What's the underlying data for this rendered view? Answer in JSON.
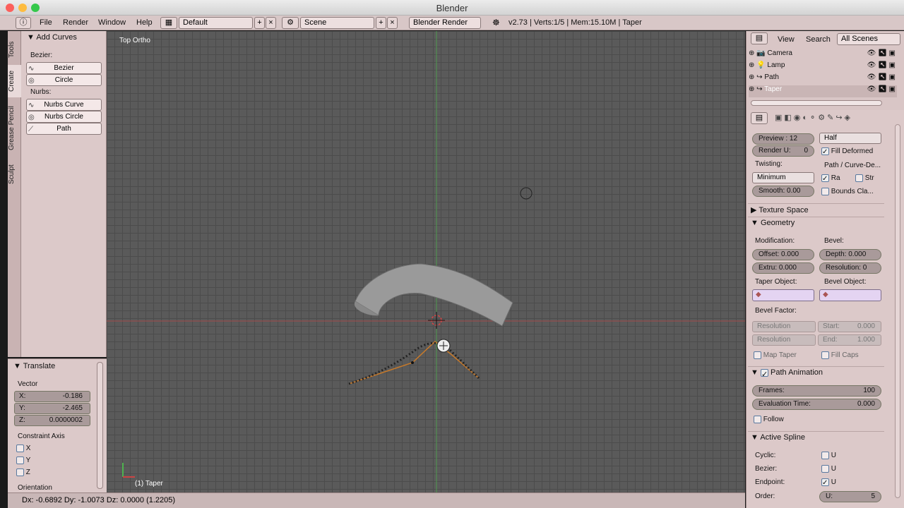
{
  "window": {
    "title": "Blender"
  },
  "menu": [
    "File",
    "Render",
    "Window",
    "Help"
  ],
  "screen_layout": "Default",
  "scene": "Scene",
  "engine": "Blender Render",
  "stats": "v2.73 | Verts:1/5 | Mem:15.10M | Taper",
  "tool_tabs": [
    "Tools",
    "Create",
    "Grease Pencil",
    "Sculpt"
  ],
  "add_curves": {
    "title": "Add Curves",
    "bezier_label": "Bezier:",
    "bezier_buttons": [
      "Bezier",
      "Circle"
    ],
    "nurbs_label": "Nurbs:",
    "nurbs_buttons": [
      "Nurbs Curve",
      "Nurbs Circle",
      "Path"
    ]
  },
  "translate": {
    "title": "Translate",
    "vector_label": "Vector",
    "x_label": "X:",
    "x": "-0.186",
    "y_label": "Y:",
    "y": "-2.465",
    "z_label": "Z:",
    "z": "0.0000002",
    "constraint_label": "Constraint Axis",
    "axes": [
      "X",
      "Y",
      "Z"
    ],
    "orientation_label": "Orientation"
  },
  "viewport": {
    "label": "Top Ortho",
    "object_label": "(1) Taper"
  },
  "status": "Dx: -0.6892   Dy: -1.0073   Dz: 0.0000 (1.2205)",
  "outliner": {
    "view": "View",
    "search": "Search",
    "filter": "All Scenes",
    "items": [
      "Camera",
      "Lamp",
      "Path",
      "Taper"
    ]
  },
  "properties": {
    "preview": "Preview : 12",
    "render_u": "Render U:",
    "render_u_value": "0",
    "fill_mode": "Half",
    "fill_deformed": "Fill Deformed",
    "twisting_label": "Twisting:",
    "twisting_value": "Minimum",
    "smooth": "Smooth: 0.00",
    "path_curve_label": "Path / Curve-De...",
    "radius_short": "Ra",
    "stretch_short": "Str",
    "bounds_clamp": "Bounds Cla...",
    "texture_space": "Texture Space",
    "geometry": "Geometry",
    "modification": "Modification:",
    "bevel": "Bevel:",
    "offset": "Offset: 0.000",
    "extrude": "Extru: 0.000",
    "depth": "Depth: 0.000",
    "resolution_bevel": "Resolution: 0",
    "taper_object": "Taper Object:",
    "bevel_object": "Bevel Object:",
    "bevel_factor": "Bevel Factor:",
    "resolution_a": "Resolution",
    "resolution_b": "Resolution",
    "start": "Start:",
    "start_value": "0.000",
    "end": "End:",
    "end_value": "1.000",
    "map_taper": "Map Taper",
    "fill_caps": "Fill Caps",
    "path_animation": "Path Animation",
    "frames": "Frames:",
    "frames_value": "100",
    "eval_time": "Evaluation Time:",
    "eval_time_value": "0.000",
    "follow": "Follow",
    "active_spline": "Active Spline",
    "cyclic": "Cyclic:",
    "bezier_row": "Bezier:",
    "endpoint": "Endpoint:",
    "order": "Order:",
    "u": "U",
    "order_u": "U:",
    "order_value": "5"
  },
  "colors": {
    "panel": "#dcc9c9",
    "header": "#d8c7c7",
    "viewport": "#5a5a5a",
    "accent_curve": "#e08a2e"
  }
}
